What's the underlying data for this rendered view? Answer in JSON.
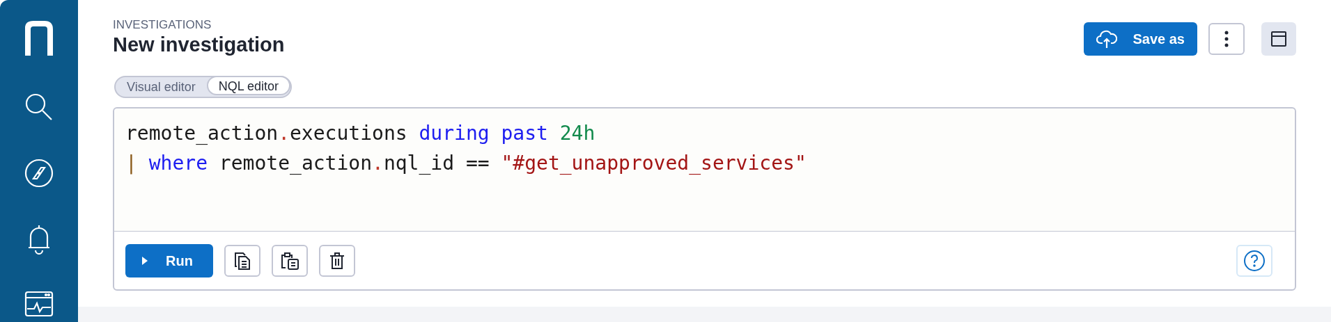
{
  "header": {
    "breadcrumb": "INVESTIGATIONS",
    "title": "New investigation"
  },
  "actions": {
    "save_label": "Save as"
  },
  "tabs": [
    {
      "label": "Visual editor",
      "selected": false
    },
    {
      "label": "NQL editor",
      "selected": true
    }
  ],
  "code_lines": [
    [
      {
        "kind": "path",
        "head": "remote_action",
        "sep": ".",
        "tail": "executions"
      },
      {
        "kind": "keyword",
        "text": " during past"
      },
      {
        "kind": "number",
        "text": " 24h"
      }
    ],
    [
      {
        "kind": "pipe",
        "text": "|"
      },
      {
        "kind": "keyword",
        "text": " where"
      },
      {
        "kind": "path",
        "head": " remote_action",
        "sep": ".",
        "tail": "nql_id == "
      },
      {
        "kind": "string",
        "text": "\"#get_unapproved_services\""
      }
    ]
  ],
  "run_label": "Run"
}
